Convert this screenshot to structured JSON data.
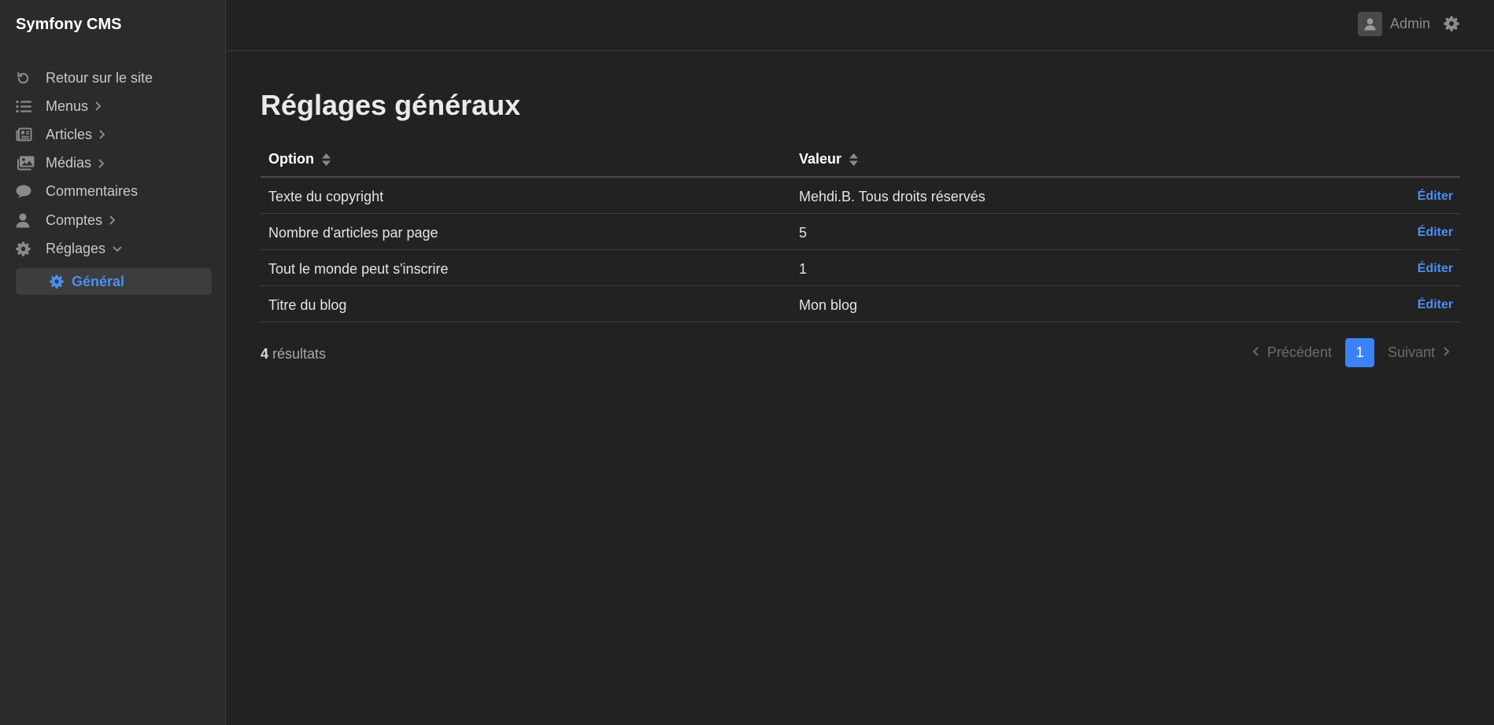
{
  "brand": "Symfony CMS",
  "sidebar": {
    "items": [
      {
        "label": "Retour sur le site",
        "icon": "undo-icon"
      },
      {
        "label": "Menus",
        "icon": "list-icon"
      },
      {
        "label": "Articles",
        "icon": "newspaper-icon"
      },
      {
        "label": "Médias",
        "icon": "photo-icon"
      },
      {
        "label": "Commentaires",
        "icon": "comment-icon"
      },
      {
        "label": "Comptes",
        "icon": "user-icon"
      },
      {
        "label": "Réglages",
        "icon": "gear-icon"
      }
    ],
    "sub_item": {
      "label": "Général",
      "icon": "gear-icon"
    }
  },
  "topbar": {
    "user_name": "Admin"
  },
  "page": {
    "title": "Réglages généraux"
  },
  "table": {
    "headers": [
      "Option",
      "Valeur"
    ],
    "rows": [
      {
        "option": "Texte du copyright",
        "value": "Mehdi.B. Tous droits réservés",
        "action": "Éditer"
      },
      {
        "option": "Nombre d'articles par page",
        "value": "5",
        "action": "Éditer"
      },
      {
        "option": "Tout le monde peut s'inscrire",
        "value": "1",
        "action": "Éditer"
      },
      {
        "option": "Titre du blog",
        "value": "Mon blog",
        "action": "Éditer"
      }
    ]
  },
  "footer": {
    "count": "4",
    "count_label": "résultats"
  },
  "pagination": {
    "prev": "Précédent",
    "current_page": "1",
    "next": "Suivant"
  },
  "colors": {
    "background": "#222222",
    "sidebar": "#2b2b2b",
    "accent": "#4a90f0",
    "page_button": "#3b82f6"
  }
}
